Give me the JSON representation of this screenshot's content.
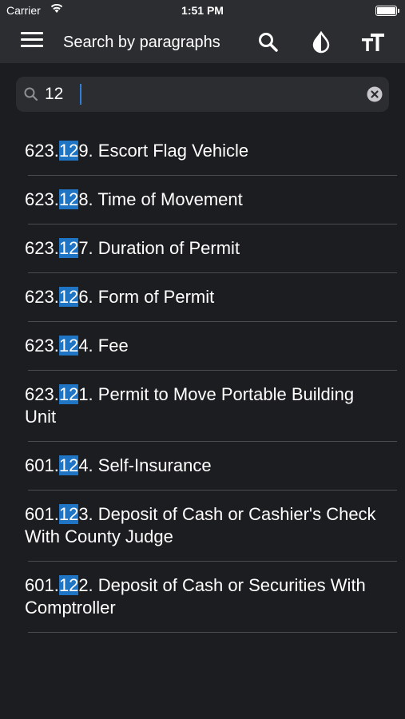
{
  "status_bar": {
    "carrier": "Carrier",
    "time": "1:51 PM"
  },
  "nav_bar": {
    "title": "Search by paragraphs",
    "icons": [
      "menu-icon",
      "search-icon",
      "contrast-icon",
      "text-size-icon"
    ]
  },
  "search": {
    "value": "12",
    "placeholder": "",
    "icons": [
      "search-icon",
      "clear-icon"
    ]
  },
  "colors": {
    "background": "#1c1d20",
    "bar": "#2b2d31",
    "highlight": "#1f74c4",
    "separator": "#4a4c51"
  },
  "results": [
    {
      "prefix": "623.",
      "match": "12",
      "suffix": "9. Escort Flag Vehicle"
    },
    {
      "prefix": "623.",
      "match": "12",
      "suffix": "8. Time of Movement"
    },
    {
      "prefix": "623.",
      "match": "12",
      "suffix": "7. Duration of Permit"
    },
    {
      "prefix": "623.",
      "match": "12",
      "suffix": "6. Form of Permit"
    },
    {
      "prefix": "623.",
      "match": "12",
      "suffix": "4. Fee"
    },
    {
      "prefix": "623.",
      "match": "12",
      "suffix": "1. Permit to Move Portable Building Unit"
    },
    {
      "prefix": "601.",
      "match": "12",
      "suffix": "4. Self-Insurance"
    },
    {
      "prefix": "601.",
      "match": "12",
      "suffix": "3. Deposit of Cash or Cashier's Check With County Judge"
    },
    {
      "prefix": "601.",
      "match": "12",
      "suffix": "2. Deposit of Cash or Securities With Comptroller"
    }
  ]
}
